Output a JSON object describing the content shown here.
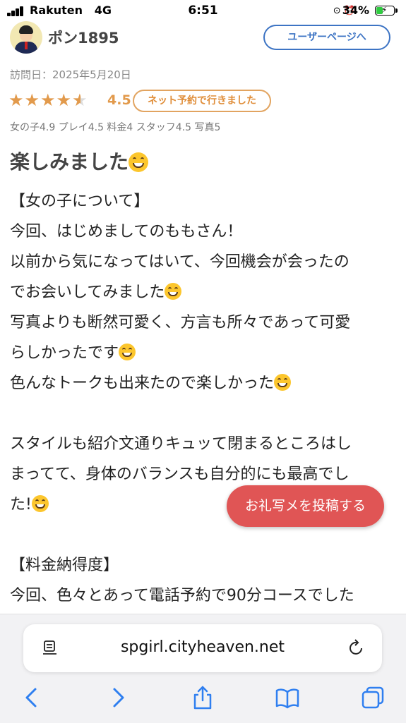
{
  "status_bar": {
    "carrier": "Rakuten",
    "network": "4G",
    "time": "6:51",
    "battery": "34%"
  },
  "reviewer": {
    "name": "ポン1895",
    "user_page_button": "ユーザーページへ"
  },
  "visit_date": "訪問日：2025年5月20日",
  "rating": {
    "overall": "4.5",
    "stars_value": 4.5,
    "badge": "ネット予約で行きました",
    "subscores": "女の子4.9 プレイ4.5 料金4 スタッフ4.5 写真5"
  },
  "review": {
    "title": "楽しみました",
    "lines": [
      "【女の子について】",
      "今回、はじめましてのももさん！",
      "以前から気になってはいて、今回機会が会ったの",
      "でお会いしてみました",
      "写真よりも断然可愛く、方言も所々であって可愛",
      "らしかったです",
      "色んなトークも出来たので楽しかった",
      "",
      "スタイルも紹介文通りキュッて閉まるところはし",
      "まってて、身体のバランスも自分的にも最高でし",
      "た!",
      "",
      "【料金納得度】",
      "今回、色々とあって電話予約で90分コースでした"
    ]
  },
  "photo_button": "お礼写メを投稿する",
  "browser": {
    "url": "spgirl.cityheaven.net"
  }
}
